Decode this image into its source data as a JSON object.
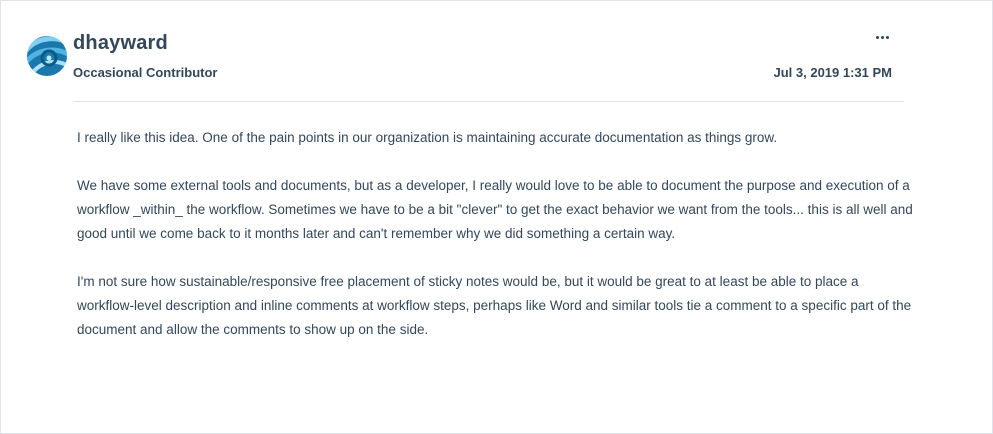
{
  "post": {
    "author": {
      "name": "dhayward",
      "rank": "Occasional Contributor",
      "avatar_icon": "avatar-swirl-icon",
      "avatar_colors": [
        "#1a7fb5",
        "#5bc0e8"
      ]
    },
    "timestamp": "Jul 3, 2019 1:31 PM",
    "menu_icon": "more-options-icon",
    "paragraphs": [
      "I really like this idea.  One of the pain points in our organization is maintaining accurate documentation as things grow.",
      "We have some external tools and documents, but as a developer, I really would love to be able to document the purpose and execution of a workflow _within_ the workflow.  Sometimes we have to be a bit \"clever\" to get the exact behavior we want from the tools... this is all well and good until we come back to it months later and can't remember why we did something a certain way.",
      "I'm not sure how sustainable/responsive free placement of sticky notes would be, but it would be great to at least be able to place a workflow-level description and inline comments at workflow steps, perhaps like Word and similar tools tie a comment to a specific part of the document and allow the comments to show up on the side."
    ]
  },
  "colors": {
    "text": "#33475b",
    "border": "#dfe3eb"
  }
}
